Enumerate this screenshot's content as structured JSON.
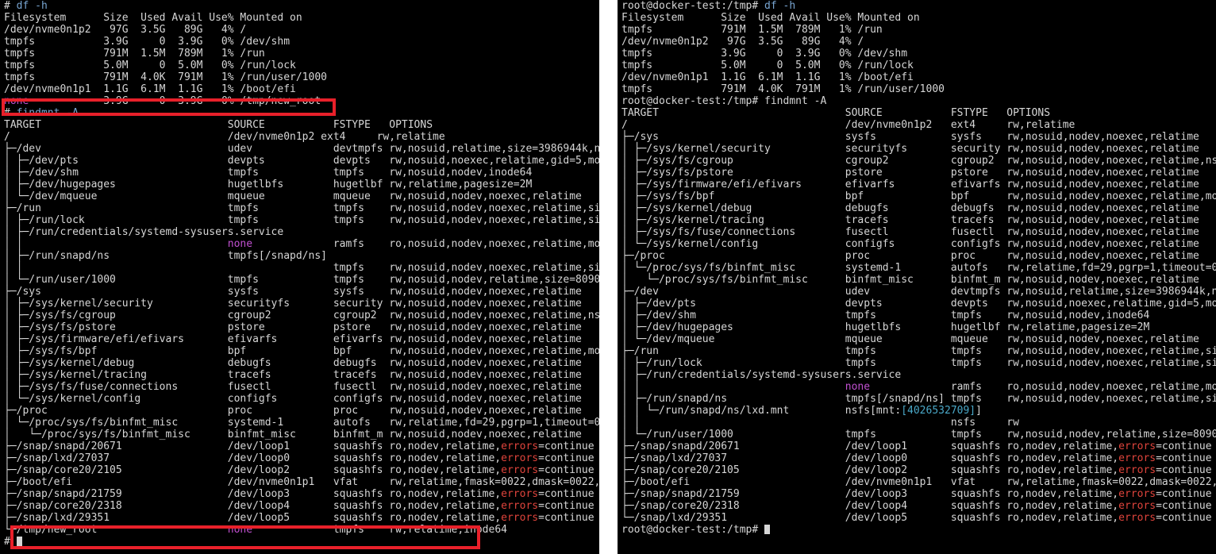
{
  "left_terminal": {
    "lines": [
      [
        "# ",
        {
          "t": "df -h",
          "c": "cmd"
        }
      ],
      [
        "Filesystem      Size  Used Avail Use% Mounted on"
      ],
      [
        "/dev/nvme0n1p2   97G  3.5G   89G   4% /"
      ],
      [
        "tmpfs           3.9G     0  3.9G   0% /dev/shm"
      ],
      [
        "tmpfs           791M  1.5M  789M   1% /run"
      ],
      [
        "tmpfs           5.0M     0  5.0M   0% /run/lock"
      ],
      [
        "tmpfs           791M  4.0K  791M   1% /run/user/1000"
      ],
      [
        "/dev/nvme0n1p1  1.1G  6.1M  1.1G   1% /boot/efi"
      ],
      [
        {
          "t": "none",
          "c": "mag"
        },
        "            3.9G     0  3.9G   0% /tmp/new_root"
      ],
      [
        "# ",
        {
          "t": "findmnt -A",
          "c": "cmd"
        }
      ],
      [
        "TARGET                              SOURCE           FSTYPE   OPTIONS"
      ],
      [
        "/                                   /dev/nvme0n1p2 ext4     rw,relatime"
      ],
      [
        "├─/dev                              udev             devtmpfs rw,nosuid,relatime,size=3986944k,nr_in"
      ],
      [
        "│ ├─/dev/pts                        devpts           devpts   rw,nosuid,noexec,relatime,gid=5,mode=6"
      ],
      [
        "│ ├─/dev/shm                        tmpfs            tmpfs    rw,nosuid,nodev,inode64"
      ],
      [
        "│ ├─/dev/hugepages                  hugetlbfs        hugetlbf rw,relatime,pagesize=2M"
      ],
      [
        "│ └─/dev/mqueue                     mqueue           mqueue   rw,nosuid,nodev,noexec,relatime"
      ],
      [
        "├─/run                              tmpfs            tmpfs    rw,nosuid,nodev,noexec,relatime,size=8"
      ],
      [
        "│ ├─/run/lock                       tmpfs            tmpfs    rw,nosuid,nodev,noexec,relatime,size=5"
      ],
      [
        "│ ├─/run/credentials/systemd-sysusers.service"
      ],
      [
        "│ │                                 ",
        {
          "t": "none",
          "c": "mag"
        },
        "             ramfs    ro,nosuid,nodev,noexec,relatime,mode=7"
      ],
      [
        "│ ├─/run/snapd/ns                   tmpfs[/snapd/ns]"
      ],
      [
        "│ │                                                  tmpfs    rw,nosuid,nodev,noexec,relatime,size=8"
      ],
      [
        "│ └─/run/user/1000                  tmpfs            tmpfs    rw,nosuid,nodev,relatime,size=809096k,"
      ],
      [
        "├─/sys                              sysfs            sysfs    rw,nosuid,nodev,noexec,relatime"
      ],
      [
        "│ ├─/sys/kernel/security            securityfs       security rw,nosuid,nodev,noexec,relatime"
      ],
      [
        "│ ├─/sys/fs/cgroup                  cgroup2          cgroup2  rw,nosuid,nodev,noexec,relatime,nsdele"
      ],
      [
        "│ ├─/sys/fs/pstore                  pstore           pstore   rw,nosuid,nodev,noexec,relatime"
      ],
      [
        "│ ├─/sys/firmware/efi/efivars       efivarfs         efivarfs rw,nosuid,nodev,noexec,relatime"
      ],
      [
        "│ ├─/sys/fs/bpf                     bpf              bpf      rw,nosuid,nodev,noexec,relatime,mode=7"
      ],
      [
        "│ ├─/sys/kernel/debug               debugfs          debugfs  rw,nosuid,nodev,noexec,relatime"
      ],
      [
        "│ ├─/sys/kernel/tracing             tracefs          tracefs  rw,nosuid,nodev,noexec,relatime"
      ],
      [
        "│ ├─/sys/fs/fuse/connections        fusectl          fusectl  rw,nosuid,nodev,noexec,relatime"
      ],
      [
        "│ └─/sys/kernel/config              configfs         configfs rw,nosuid,nodev,noexec,relatime"
      ],
      [
        "├─/proc                             proc             proc     rw,nosuid,nodev,noexec,relatime"
      ],
      [
        "│ └─/proc/sys/fs/binfmt_misc        systemd-1        autofs   rw,relatime,fd=29,pgrp=1,timeout=0,min"
      ],
      [
        "│   └─/proc/sys/fs/binfmt_misc      binfmt_misc      binfmt_m rw,nosuid,nodev,noexec,relatime"
      ],
      [
        "├─/snap/snapd/20671                 /dev/loop1       squashfs ro,nodev,relatime,",
        {
          "t": "errors",
          "c": "red"
        },
        "=continue"
      ],
      [
        "├─/snap/lxd/27037                   /dev/loop0       squashfs ro,nodev,relatime,",
        {
          "t": "errors",
          "c": "red"
        },
        "=continue"
      ],
      [
        "├─/snap/core20/2105                 /dev/loop2       squashfs ro,nodev,relatime,",
        {
          "t": "errors",
          "c": "red"
        },
        "=continue"
      ],
      [
        "├─/boot/efi                         /dev/nvme0n1p1   vfat     rw,relatime,fmask=0022,dmask=0022,code"
      ],
      [
        "├─/snap/snapd/21759                 /dev/loop3       squashfs ro,nodev,relatime,",
        {
          "t": "errors",
          "c": "red"
        },
        "=continue"
      ],
      [
        "├─/snap/core20/2318                 /dev/loop4       squashfs ro,nodev,relatime,",
        {
          "t": "errors",
          "c": "red"
        },
        "=continue"
      ],
      [
        "├─/snap/lxd/29351                   /dev/loop5       squashfs ro,nodev,relatime,",
        {
          "t": "errors",
          "c": "red"
        },
        "=continue"
      ],
      [
        "└─/tmp/new_root                     ",
        {
          "t": "none",
          "c": "mag"
        },
        "             tmpfs    rw,relatime,inode64"
      ],
      [
        "# "
      ]
    ]
  },
  "right_terminal": {
    "lines": [
      [
        "root@docker-test:/tmp# ",
        {
          "t": "df -h",
          "c": "cmd"
        }
      ],
      [
        "Filesystem      Size  Used Avail Use% Mounted on"
      ],
      [
        "tmpfs           791M  1.5M  789M   1% /run"
      ],
      [
        "/dev/nvme0n1p2   97G  3.5G   89G   4% /"
      ],
      [
        "tmpfs           3.9G     0  3.9G   0% /dev/shm"
      ],
      [
        "tmpfs           5.0M     0  5.0M   0% /run/lock"
      ],
      [
        "/dev/nvme0n1p1  1.1G  6.1M  1.1G   1% /boot/efi"
      ],
      [
        "tmpfs           791M  4.0K  791M   1% /run/user/1000"
      ],
      [
        "root@docker-test:/tmp# findmnt -A"
      ],
      [
        "TARGET                              SOURCE           FSTYPE   OPTIONS"
      ],
      [
        "/                                   /dev/nvme0n1p2   ext4     rw,relatime"
      ],
      [
        "├─/sys                              sysfs            sysfs    rw,nosuid,nodev,noexec,relatime"
      ],
      [
        "│ ├─/sys/kernel/security            securityfs       security rw,nosuid,nodev,noexec,relatime"
      ],
      [
        "│ ├─/sys/fs/cgroup                  cgroup2          cgroup2  rw,nosuid,nodev,noexec,relatime,nsde"
      ],
      [
        "│ ├─/sys/fs/pstore                  pstore           pstore   rw,nosuid,nodev,noexec,relatime"
      ],
      [
        "│ ├─/sys/firmware/efi/efivars       efivarfs         efivarfs rw,nosuid,nodev,noexec,relatime"
      ],
      [
        "│ ├─/sys/fs/bpf                     bpf              bpf      rw,nosuid,nodev,noexec,relatime,mode"
      ],
      [
        "│ ├─/sys/kernel/debug               debugfs          debugfs  rw,nosuid,nodev,noexec,relatime"
      ],
      [
        "│ ├─/sys/kernel/tracing             tracefs          tracefs  rw,nosuid,nodev,noexec,relatime"
      ],
      [
        "│ ├─/sys/fs/fuse/connections        fusectl          fusectl  rw,nosuid,nodev,noexec,relatime"
      ],
      [
        "│ └─/sys/kernel/config              configfs         configfs rw,nosuid,nodev,noexec,relatime"
      ],
      [
        "├─/proc                             proc             proc     rw,nosuid,nodev,noexec,relatime"
      ],
      [
        "│ └─/proc/sys/fs/binfmt_misc        systemd-1        autofs   rw,relatime,fd=29,pgrp=1,timeout=0,m"
      ],
      [
        "│   └─/proc/sys/fs/binfmt_misc      binfmt_misc      binfmt_m rw,nosuid,nodev,noexec,relatime"
      ],
      [
        "├─/dev                              udev             devtmpfs rw,nosuid,relatime,size=3986944k,nr_"
      ],
      [
        "│ ├─/dev/pts                        devpts           devpts   rw,nosuid,noexec,relatime,gid=5,mode"
      ],
      [
        "│ ├─/dev/shm                        tmpfs            tmpfs    rw,nosuid,nodev,inode64"
      ],
      [
        "│ ├─/dev/hugepages                  hugetlbfs        hugetlbf rw,relatime,pagesize=2M"
      ],
      [
        "│ └─/dev/mqueue                     mqueue           mqueue   rw,nosuid,nodev,noexec,relatime"
      ],
      [
        "├─/run                              tmpfs            tmpfs    rw,nosuid,nodev,noexec,relatime,size"
      ],
      [
        "│ ├─/run/lock                       tmpfs            tmpfs    rw,nosuid,nodev,noexec,relatime,size"
      ],
      [
        "│ ├─/run/credentials/systemd-sysusers.service"
      ],
      [
        "│ │                                 ",
        {
          "t": "none",
          "c": "mag"
        },
        "             ramfs    ro,nosuid,nodev,noexec,relatime,mode"
      ],
      [
        "│ ├─/run/snapd/ns                   tmpfs[/snapd/ns] tmpfs    rw,nosuid,nodev,noexec,relatime,size"
      ],
      [
        "│ │ └─/run/snapd/ns/lxd.mnt         nsfs[mnt:",
        {
          "t": "[4026532709]",
          "c": "cyan"
        },
        "]"
      ],
      [
        "│ │                                                  nsfs     rw"
      ],
      [
        "│ └─/run/user/1000                  tmpfs            tmpfs    rw,nosuid,nodev,relatime,size=809096"
      ],
      [
        "├─/snap/snapd/20671                 /dev/loop1       squashfs ro,nodev,relatime,",
        {
          "t": "errors",
          "c": "red"
        },
        "=continue"
      ],
      [
        "├─/snap/lxd/27037                   /dev/loop0       squashfs ro,nodev,relatime,",
        {
          "t": "errors",
          "c": "red"
        },
        "=continue"
      ],
      [
        "├─/snap/core20/2105                 /dev/loop2       squashfs ro,nodev,relatime,",
        {
          "t": "errors",
          "c": "red"
        },
        "=continue"
      ],
      [
        "├─/boot/efi                         /dev/nvme0n1p1   vfat     rw,relatime,fmask=0022,dmask=0022,co"
      ],
      [
        "├─/snap/snapd/21759                 /dev/loop3       squashfs ro,nodev,relatime,",
        {
          "t": "errors",
          "c": "red"
        },
        "=continue"
      ],
      [
        "├─/snap/core20/2318                 /dev/loop4       squashfs ro,nodev,relatime,",
        {
          "t": "errors",
          "c": "red"
        },
        "=continue"
      ],
      [
        "└─/snap/lxd/29351                   /dev/loop5       squashfs ro,nodev,relatime,",
        {
          "t": "errors",
          "c": "red"
        },
        "=continue"
      ],
      [
        "root@docker-test:/tmp# "
      ]
    ]
  },
  "colors": {
    "background": "#000000",
    "text": "#d6d6d6",
    "command": "#79a6d2",
    "magenta": "#c050d0",
    "red": "#e0443c",
    "cyan": "#4aa8c8",
    "highlight_box": "#e8202a"
  }
}
